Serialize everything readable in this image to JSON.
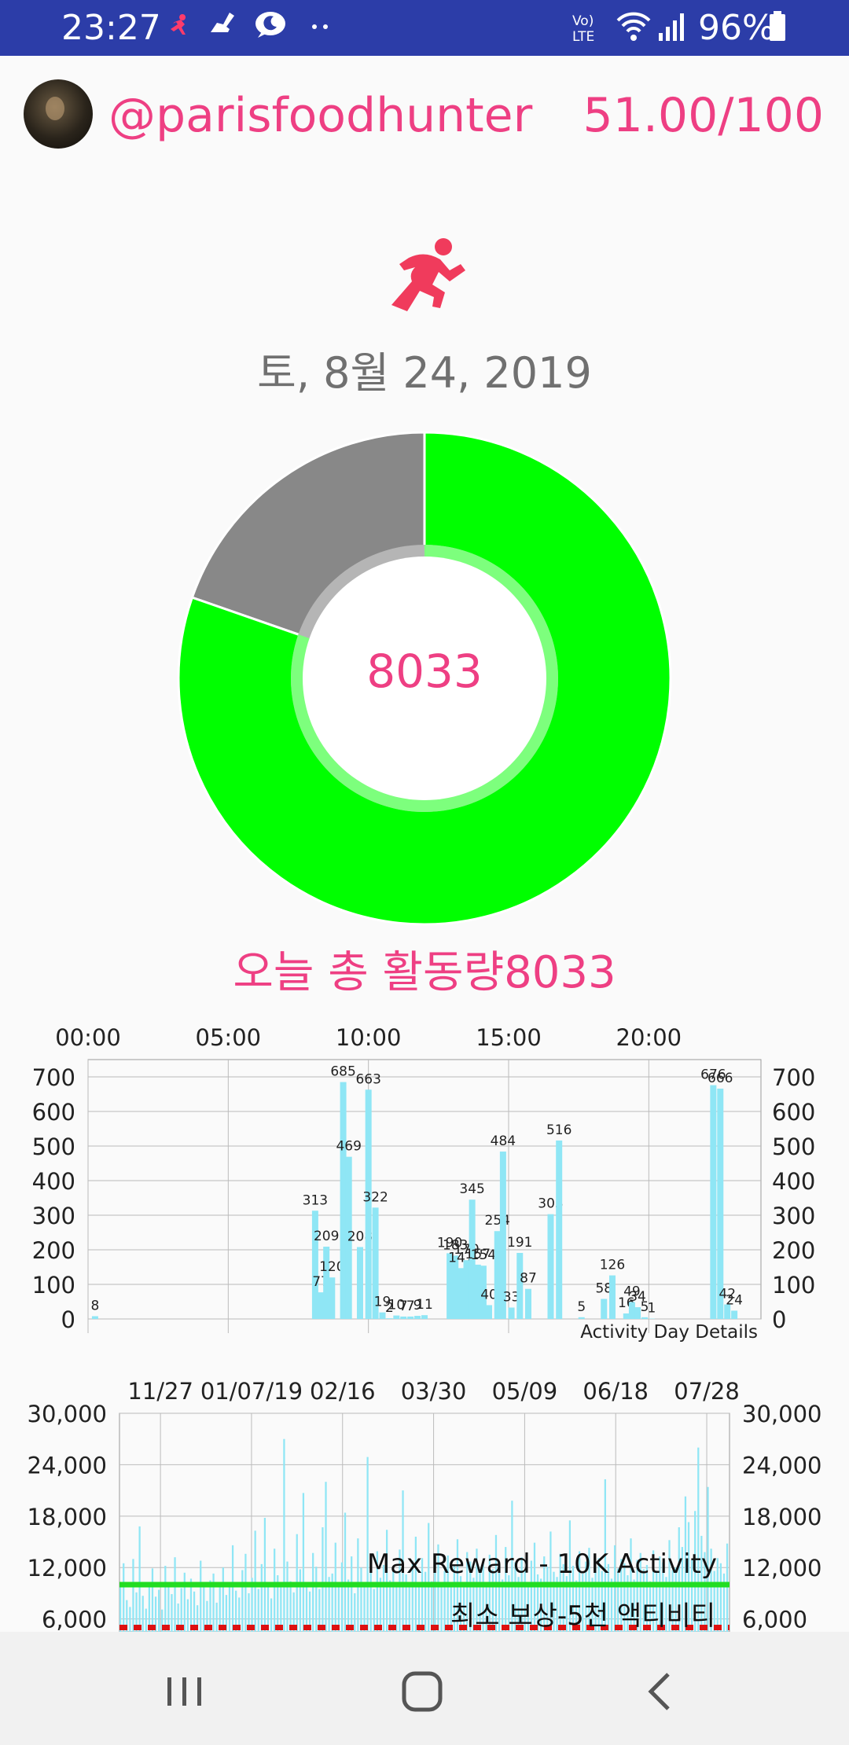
{
  "status_bar": {
    "time": "23:27",
    "battery": "96%",
    "icons": [
      "running-icon",
      "broom-icon",
      "chat-moon-icon",
      "more-dots-icon",
      "volte-icon",
      "wifi-icon",
      "signal-icon",
      "battery-icon"
    ]
  },
  "profile": {
    "username": "@parisfoodhunter",
    "score": "51.00/100"
  },
  "activity": {
    "date": "토, 8월 24, 2019",
    "today_total": "8033",
    "today_total_label": "오늘 총 활동량8033",
    "donut": {
      "progress": 0.8033,
      "goal": 10000,
      "colors": {
        "done": "#00ff00",
        "remaining": "#888888",
        "inner_ring": "#7dff7d"
      }
    }
  },
  "accent_colors": {
    "pink": "#ee3f83",
    "bar": "#8fe6f5",
    "max_line": "#22dd22",
    "min_line": "#dd1111",
    "status_bar": "#2c3da8"
  },
  "chart_data": [
    {
      "type": "bar",
      "title": "Activity Day Details",
      "x_tick_labels": [
        "00:00",
        "05:00",
        "10:00",
        "15:00",
        "20:00"
      ],
      "x_range_hours": [
        0,
        24
      ],
      "y_ticks": [
        0,
        100,
        200,
        300,
        400,
        500,
        600,
        700
      ],
      "ylim": [
        0,
        750
      ],
      "grid": true,
      "bars": [
        {
          "hour": 0.25,
          "value": 8,
          "label": "8"
        },
        {
          "hour": 8.1,
          "value": 313,
          "label": "313"
        },
        {
          "hour": 8.3,
          "value": 77,
          "label": "77"
        },
        {
          "hour": 8.5,
          "value": 209,
          "label": "209"
        },
        {
          "hour": 8.7,
          "value": 120,
          "label": "120"
        },
        {
          "hour": 9.1,
          "value": 685,
          "label": "685"
        },
        {
          "hour": 9.3,
          "value": 469,
          "label": "469"
        },
        {
          "hour": 9.7,
          "value": 208,
          "label": "208"
        },
        {
          "hour": 10.0,
          "value": 663,
          "label": "663"
        },
        {
          "hour": 10.25,
          "value": 322,
          "label": "322"
        },
        {
          "hour": 10.5,
          "value": 19,
          "label": "19"
        },
        {
          "hour": 10.75,
          "value": 2,
          "label": "2"
        },
        {
          "hour": 11.0,
          "value": 10,
          "label": "10"
        },
        {
          "hour": 11.25,
          "value": 7,
          "label": "7"
        },
        {
          "hour": 11.5,
          "value": 7,
          "label": "7"
        },
        {
          "hour": 11.75,
          "value": 9,
          "label": "9"
        },
        {
          "hour": 12.0,
          "value": 11,
          "label": "11"
        },
        {
          "hour": 12.9,
          "value": 190,
          "label": "190"
        },
        {
          "hour": 13.1,
          "value": 183,
          "label": "183"
        },
        {
          "hour": 13.3,
          "value": 147,
          "label": "147"
        },
        {
          "hour": 13.5,
          "value": 170,
          "label": "170"
        },
        {
          "hour": 13.7,
          "value": 345,
          "label": "345"
        },
        {
          "hour": 13.9,
          "value": 157,
          "label": "157"
        },
        {
          "hour": 14.1,
          "value": 154,
          "label": "154"
        },
        {
          "hour": 14.3,
          "value": 40,
          "label": "40"
        },
        {
          "hour": 14.6,
          "value": 254,
          "label": "254"
        },
        {
          "hour": 14.8,
          "value": 484,
          "label": "484"
        },
        {
          "hour": 15.1,
          "value": 33,
          "label": "33"
        },
        {
          "hour": 15.4,
          "value": 191,
          "label": "191"
        },
        {
          "hour": 15.7,
          "value": 87,
          "label": "87"
        },
        {
          "hour": 16.5,
          "value": 303,
          "label": "303"
        },
        {
          "hour": 16.8,
          "value": 516,
          "label": "516"
        },
        {
          "hour": 17.6,
          "value": 5,
          "label": "5"
        },
        {
          "hour": 18.4,
          "value": 58,
          "label": "58"
        },
        {
          "hour": 18.7,
          "value": 126,
          "label": "126"
        },
        {
          "hour": 19.2,
          "value": 16,
          "label": "16"
        },
        {
          "hour": 19.4,
          "value": 49,
          "label": "49"
        },
        {
          "hour": 19.6,
          "value": 34,
          "label": "34"
        },
        {
          "hour": 19.85,
          "value": 5,
          "label": "5"
        },
        {
          "hour": 20.1,
          "value": 1,
          "label": "1"
        },
        {
          "hour": 22.3,
          "value": 676,
          "label": "676"
        },
        {
          "hour": 22.55,
          "value": 666,
          "label": "666"
        },
        {
          "hour": 22.8,
          "value": 42,
          "label": "42"
        },
        {
          "hour": 23.05,
          "value": 24,
          "label": "24"
        }
      ]
    },
    {
      "type": "bar",
      "title": "",
      "x_tick_labels": [
        "11/27",
        "01/07/19",
        "02/16",
        "03/30",
        "05/09",
        "06/18",
        "07/28"
      ],
      "y_ticks": [
        6000,
        12000,
        18000,
        24000,
        30000
      ],
      "y_tick_labels": [
        "6,000",
        "12,000",
        "18,000",
        "24,000",
        "30,000"
      ],
      "ylim": [
        4500,
        30000
      ],
      "grid": true,
      "reference_lines": [
        {
          "label": "Max Reward - 10K Activity",
          "value": 10000,
          "style": "solid",
          "color": "#22dd22"
        },
        {
          "label": "최소 보상-5천 액티비티",
          "value": 5000,
          "style": "dashed",
          "color": "#dd1111"
        }
      ],
      "daily_values_note": "dense daily bars, mostly 6,000–14,000 with peaks near 27,000",
      "values": [
        9800,
        12500,
        8200,
        7400,
        13000,
        9100,
        16800,
        8700,
        7200,
        10300,
        11900,
        8600,
        9400,
        7100,
        12200,
        10100,
        8900,
        13200,
        7800,
        9600,
        11400,
        8300,
        10700,
        9200,
        7600,
        12800,
        9900,
        8100,
        10500,
        11300,
        7900,
        9700,
        12000,
        8800,
        10200,
        14600,
        9300,
        8500,
        11700,
        13600,
        9000,
        10800,
        16300,
        9500,
        12400,
        17800,
        10000,
        8400,
        14200,
        11100,
        9700,
        27000,
        12700,
        10400,
        9100,
        15900,
        11800,
        20700,
        10300,
        9200,
        13700,
        12100,
        9500,
        16700,
        22000,
        10900,
        11300,
        14900,
        9800,
        12600,
        18400,
        10600,
        13300,
        9000,
        15400,
        12000,
        10100,
        24900,
        11700,
        9500,
        13900,
        10800,
        12300,
        16400,
        10500,
        11900,
        9700,
        14100,
        21000,
        11200,
        10200,
        12800,
        15600,
        9900,
        13100,
        11500,
        17200,
        10400,
        12500,
        14700,
        9800,
        11600,
        13400,
        10300,
        12200,
        15300,
        11000,
        9700,
        13800,
        12700,
        10800,
        14200,
        11400,
        12900,
        10000,
        13500,
        11800,
        15800,
        12300,
        10600,
        14400,
        11100,
        19800,
        12600,
        10900,
        13200,
        11700,
        10300,
        12800,
        14900,
        11200,
        10700,
        13300,
        12100,
        16200,
        11500,
        10900,
        13600,
        12400,
        11000,
        17500,
        12200,
        10500,
        13900,
        11300,
        12700,
        14300,
        10800,
        12000,
        13100,
        11600,
        22300,
        12400,
        10700,
        14600,
        11900,
        13000,
        12500,
        11100,
        15400,
        10600,
        12900,
        13700,
        11800,
        12300,
        10400,
        14000,
        11500,
        13300,
        12600,
        10900,
        15200,
        11700,
        12000,
        16700,
        14400,
        20300,
        17300,
        12900,
        18600,
        26000,
        15700,
        13800,
        21400,
        14200,
        11600,
        13100,
        12500,
        11300,
        14800
      ]
    }
  ],
  "second_chart_labels": {
    "max_reward": "Max Reward - 10K Activity",
    "min_reward": "최소 보상-5천 액티비티"
  },
  "nav": {
    "buttons": [
      "recent-apps",
      "home",
      "back"
    ]
  }
}
